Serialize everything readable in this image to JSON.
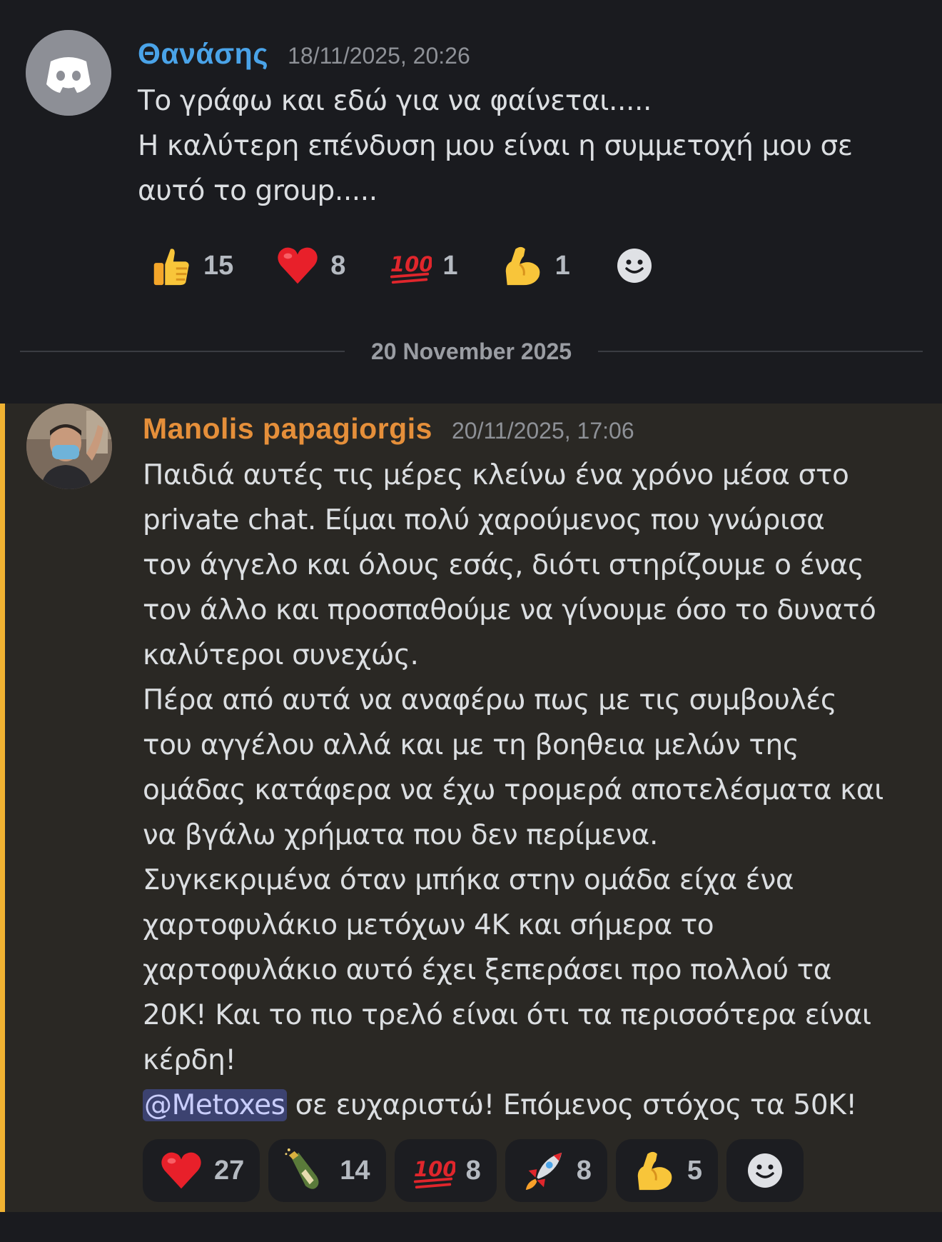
{
  "messages": [
    {
      "author": "Θανάσης",
      "author_color": "#4aa3e8",
      "timestamp": "18/11/2025, 20:26",
      "avatar": "discord-logo-icon",
      "lines": [
        "Το γράφω και εδώ για να φαίνεται.....",
        "Η καλύτερη επένδυση μου είναι η συμμετοχή μου σε",
        "αυτό το group....."
      ],
      "reactions": [
        {
          "emoji": "thumbs-up-icon",
          "count": "15"
        },
        {
          "emoji": "red-heart-icon",
          "count": "8"
        },
        {
          "emoji": "hundred-points-icon",
          "count": "1"
        },
        {
          "emoji": "flexed-biceps-icon",
          "count": "1"
        }
      ],
      "add_reaction": "add-reaction-icon"
    },
    {
      "author": "Manolis papagiorgis",
      "author_color": "#e58f3a",
      "timestamp": "20/11/2025, 17:06",
      "avatar": "user-photo-avatar",
      "highlight_color": "#f0b232",
      "lines": [
        "Παιδιά αυτές τις μέρες κλείνω ένα χρόνο μέσα στο",
        "private chat. Είμαι πολύ χαρούμενος που γνώρισα",
        "τον άγγελο και όλους εσάς, διότι στηρίζουμε ο ένας",
        "τον άλλο και προσπαθούμε να γίνουμε όσο το δυνατό",
        "καλύτεροι συνεχώς.",
        "Πέρα από αυτά να αναφέρω πως με τις συμβουλές",
        "του αγγέλου αλλά και με τη βοηθεια μελών της",
        "ομάδας κατάφερα να έχω τρομερά αποτελέσματα και",
        "να βγάλω χρήματα που δεν περίμενα.",
        "Συγκεκριμένα όταν μπήκα στην ομάδα είχα ένα",
        "χαρτοφυλάκιο μετόχων 4Κ  και σήμερα το",
        "χαρτοφυλάκιο αυτό έχει ξεπεράσει προ πολλού τα",
        "20Κ! Και το πιο τρελό είναι ότι τα περισσότερα είναι",
        "κέρδη!"
      ],
      "mention": "@Metoxes",
      "last_line_rest": " σε ευχαριστώ! Επόμενος στόχος τα 50Κ!",
      "reactions": [
        {
          "emoji": "red-heart-icon",
          "count": "27"
        },
        {
          "emoji": "champagne-bottle-icon",
          "count": "14"
        },
        {
          "emoji": "hundred-points-icon",
          "count": "8"
        },
        {
          "emoji": "rocket-icon",
          "count": "8"
        },
        {
          "emoji": "flexed-biceps-icon",
          "count": "5"
        }
      ],
      "add_reaction": "add-reaction-icon"
    }
  ],
  "date_divider": "20 November 2025"
}
